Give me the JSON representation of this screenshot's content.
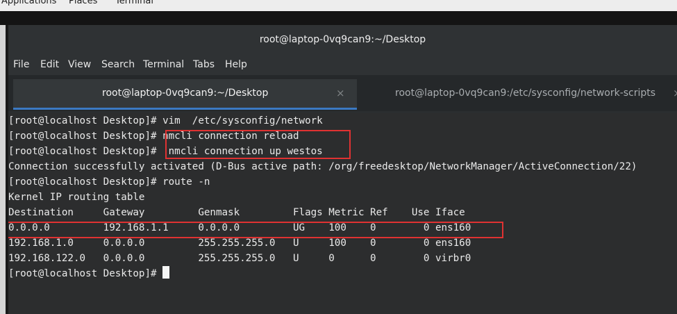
{
  "system_bar": {
    "menus": [
      "Applications",
      "Places",
      "Terminal"
    ]
  },
  "window": {
    "title": "root@laptop-0vq9can9:~/Desktop"
  },
  "menubar": {
    "items": [
      "File",
      "Edit",
      "View",
      "Search",
      "Terminal",
      "Tabs",
      "Help"
    ]
  },
  "tabs": [
    {
      "label": "root@laptop-0vq9can9:~/Desktop",
      "active": true,
      "close": "×"
    },
    {
      "label": "root@laptop-0vq9can9:/etc/sysconfig/network-scripts",
      "active": false,
      "close": "×"
    }
  ],
  "terminal": {
    "lines": [
      "[root@localhost Desktop]# vim  /etc/sysconfig/network",
      "[root@localhost Desktop]# nmcli connection reload",
      "[root@localhost Desktop]#  nmcli connection up westos",
      "Connection successfully activated (D-Bus active path: /org/freedesktop/NetworkManager/ActiveConnection/22)",
      "[root@localhost Desktop]# route -n",
      "Kernel IP routing table",
      "Destination     Gateway         Genmask         Flags Metric Ref    Use Iface",
      "0.0.0.0         192.168.1.1     0.0.0.0         UG    100    0        0 ens160",
      "192.168.1.0     0.0.0.0         255.255.255.0   U     100    0        0 ens160",
      "192.168.122.0   0.0.0.0         255.255.255.0   U     0      0        0 virbr0",
      "[root@localhost Desktop]# "
    ]
  },
  "colors": {
    "highlight": "#e03232",
    "active_tab_underline": "#3b79c3"
  }
}
